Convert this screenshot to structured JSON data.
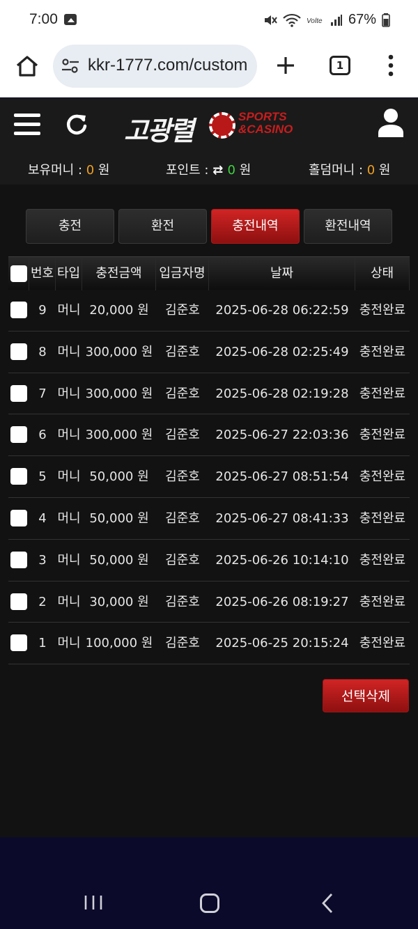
{
  "status_bar": {
    "time": "7:00",
    "battery": "67%"
  },
  "browser": {
    "url": "kkr-1777.com/custom",
    "tab_count": "1"
  },
  "site": {
    "logo_text": "고광렬",
    "logo_sub1": "SPORTS",
    "logo_sub2": "&CASINO"
  },
  "balances": {
    "money_label": "보유머니 : ",
    "money_value": "0",
    "point_label": "포인트 : ",
    "point_value": "0",
    "holdem_label": "홀덤머니 : ",
    "holdem_value": "0",
    "unit": " 원"
  },
  "tabs": [
    {
      "label": "충전",
      "active": false
    },
    {
      "label": "환전",
      "active": false
    },
    {
      "label": "충전내역",
      "active": true
    },
    {
      "label": "환전내역",
      "active": false
    }
  ],
  "table": {
    "headers": [
      "번호",
      "타입",
      "충전금액",
      "입금자명",
      "날짜",
      "상태"
    ],
    "rows": [
      {
        "no": "9",
        "type": "머니",
        "amount": "20,000 원",
        "name": "김준호",
        "date": "2025-06-28 06:22:59",
        "status": "충전완료"
      },
      {
        "no": "8",
        "type": "머니",
        "amount": "300,000 원",
        "name": "김준호",
        "date": "2025-06-28 02:25:49",
        "status": "충전완료"
      },
      {
        "no": "7",
        "type": "머니",
        "amount": "300,000 원",
        "name": "김준호",
        "date": "2025-06-28 02:19:28",
        "status": "충전완료"
      },
      {
        "no": "6",
        "type": "머니",
        "amount": "300,000 원",
        "name": "김준호",
        "date": "2025-06-27 22:03:36",
        "status": "충전완료"
      },
      {
        "no": "5",
        "type": "머니",
        "amount": "50,000 원",
        "name": "김준호",
        "date": "2025-06-27 08:51:54",
        "status": "충전완료"
      },
      {
        "no": "4",
        "type": "머니",
        "amount": "50,000 원",
        "name": "김준호",
        "date": "2025-06-27 08:41:33",
        "status": "충전완료"
      },
      {
        "no": "3",
        "type": "머니",
        "amount": "50,000 원",
        "name": "김준호",
        "date": "2025-06-26 10:14:10",
        "status": "충전완료"
      },
      {
        "no": "2",
        "type": "머니",
        "amount": "30,000 원",
        "name": "김준호",
        "date": "2025-06-26 08:19:27",
        "status": "충전완료"
      },
      {
        "no": "1",
        "type": "머니",
        "amount": "100,000 원",
        "name": "김준호",
        "date": "2025-06-25 20:15:24",
        "status": "충전완료"
      }
    ]
  },
  "delete_button": "선택삭제",
  "colors": {
    "accent_red": "#c91d1d",
    "value_orange": "#f0a020",
    "value_green": "#3fd43f"
  }
}
